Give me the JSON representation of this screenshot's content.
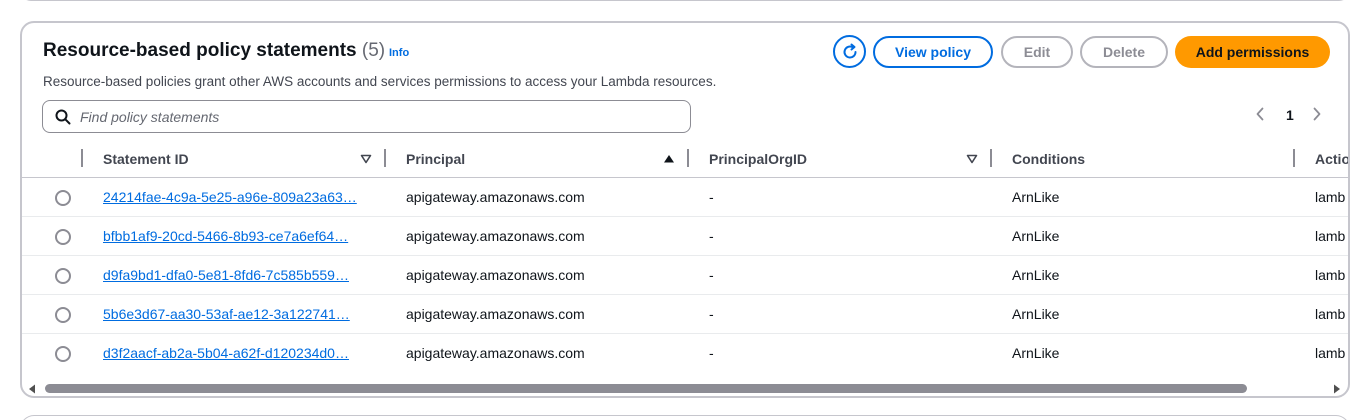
{
  "header": {
    "title": "Resource-based policy statements",
    "count": "(5)",
    "info_label": "Info",
    "description": "Resource-based policies grant other AWS accounts and services permissions to access your Lambda resources."
  },
  "actions": {
    "view_policy": "View policy",
    "edit": "Edit",
    "delete": "Delete",
    "add_permissions": "Add permissions"
  },
  "search": {
    "placeholder": "Find policy statements"
  },
  "pagination": {
    "current_page": "1"
  },
  "table": {
    "columns": [
      "Statement ID",
      "Principal",
      "PrincipalOrgID",
      "Conditions",
      "Actio"
    ],
    "rows": [
      {
        "statement_id": "24214fae-4c9a-5e25-a96e-809a23a63…",
        "principal": "apigateway.amazonaws.com",
        "org_id": "-",
        "conditions": "ArnLike",
        "action": "lamb"
      },
      {
        "statement_id": "bfbb1af9-20cd-5466-8b93-ce7a6ef64…",
        "principal": "apigateway.amazonaws.com",
        "org_id": "-",
        "conditions": "ArnLike",
        "action": "lamb"
      },
      {
        "statement_id": "d9fa9bd1-dfa0-5e81-8fd6-7c585b559…",
        "principal": "apigateway.amazonaws.com",
        "org_id": "-",
        "conditions": "ArnLike",
        "action": "lamb"
      },
      {
        "statement_id": "5b6e3d67-aa30-53af-ae12-3a122741…",
        "principal": "apigateway.amazonaws.com",
        "org_id": "-",
        "conditions": "ArnLike",
        "action": "lamb"
      },
      {
        "statement_id": "d3f2aacf-ab2a-5b04-a62f-d120234d0…",
        "principal": "apigateway.amazonaws.com",
        "org_id": "-",
        "conditions": "ArnLike",
        "action": "lamb"
      }
    ]
  },
  "icons": {
    "refresh": "refresh-icon",
    "search": "search-icon",
    "prev": "chevron-left-icon",
    "next": "chevron-right-icon",
    "sort_desc": "caret-down-outline-icon",
    "sort_asc": "caret-up-filled-icon"
  },
  "colors": {
    "primary": "#ff9900",
    "link": "#006ce0",
    "disabled": "#8c8c94",
    "border": "#c6c6cd",
    "text": "#0f141a"
  }
}
